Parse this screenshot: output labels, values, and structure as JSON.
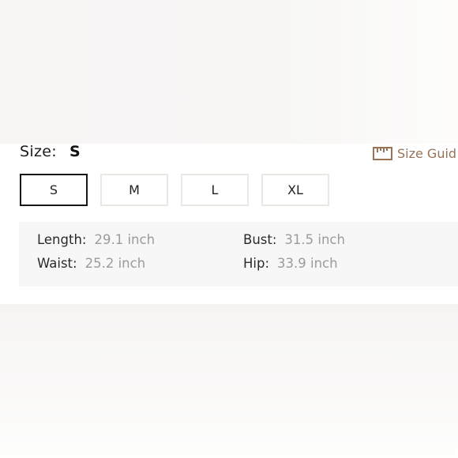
{
  "product": {
    "size_label": "Size:",
    "selected_size": "S",
    "size_guide_label": "Size Guid",
    "size_guide_icon": "ruler-icon",
    "accent_color": "#9a7357"
  },
  "size_options": [
    {
      "label": "S",
      "selected": true
    },
    {
      "label": "M",
      "selected": false
    },
    {
      "label": "L",
      "selected": false
    },
    {
      "label": "XL",
      "selected": false
    }
  ],
  "measurements": [
    {
      "label": "Length:",
      "value": "29.1 inch"
    },
    {
      "label": "Bust:",
      "value": "31.5 inch"
    },
    {
      "label": "Waist:",
      "value": "25.2 inch"
    },
    {
      "label": "Hip:",
      "value": "33.9 inch"
    }
  ]
}
